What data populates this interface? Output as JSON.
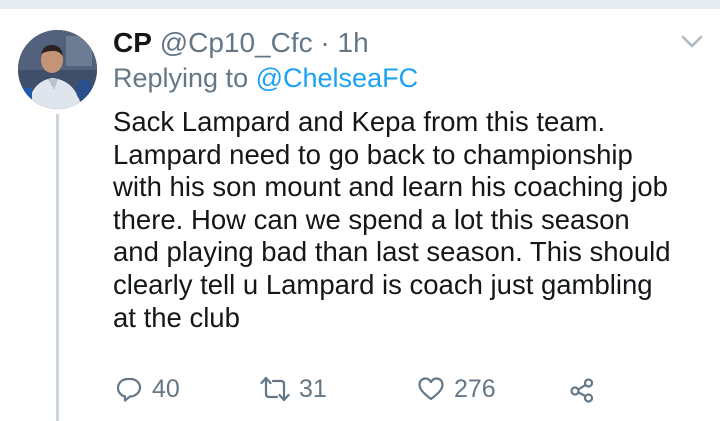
{
  "tweet": {
    "display_name": "CP",
    "handle": "@Cp10_Cfc",
    "separator": "·",
    "timestamp": "1h",
    "replying_prefix": "Replying to",
    "replying_to": "@ChelseaFC",
    "text_lines": [
      "Sack Lampard and Kepa from this team.",
      "Lampard need to go back to championship",
      "with his son mount and learn his coaching job",
      "there. How can we spend a lot this season",
      "and playing bad than last season. This should",
      "clearly tell u Lampard is coach just gambling",
      "at the club"
    ],
    "actions": {
      "reply_count": "40",
      "retweet_count": "31",
      "like_count": "276"
    }
  },
  "icons": {
    "menu": "chevron-down-icon",
    "reply": "reply-icon",
    "retweet": "retweet-icon",
    "like": "heart-icon",
    "share": "share-icon"
  },
  "colors": {
    "text": "#14171a",
    "secondary": "#657786",
    "link": "#1da1f2",
    "divider": "#e6ecf0",
    "thread_line": "#ccd6dd"
  }
}
